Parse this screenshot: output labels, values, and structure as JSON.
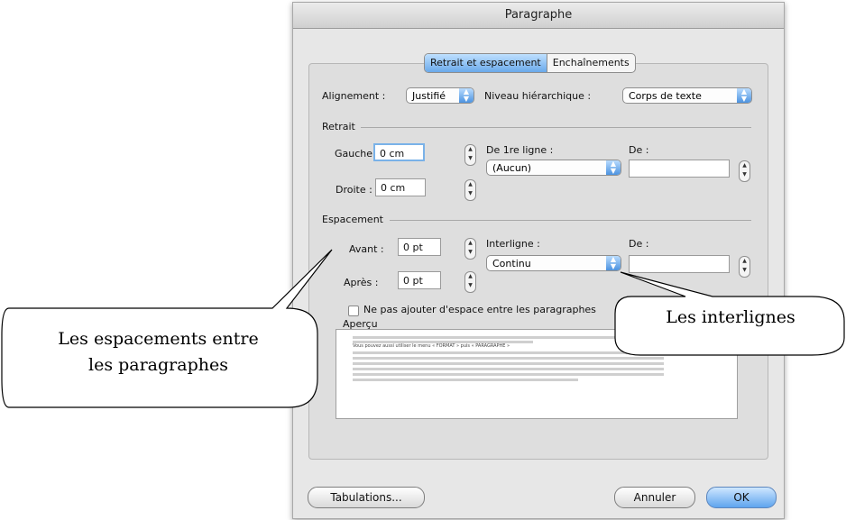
{
  "dialog": {
    "title": "Paragraphe",
    "tabs": [
      "Retrait et espacement",
      "Enchaînements"
    ],
    "alignment": {
      "label": "Alignement :",
      "value": "Justifié"
    },
    "level": {
      "label": "Niveau hiérarchique :",
      "value": "Corps de texte"
    },
    "indent": {
      "section": "Retrait",
      "left_label": "Gauche :",
      "left_value": "0 cm",
      "right_label": "Droite :",
      "right_value": "0 cm",
      "first_line_label": "De 1re ligne :",
      "first_line_value": "(Aucun)",
      "by_label": "De :",
      "by_value": ""
    },
    "spacing": {
      "section": "Espacement",
      "before_label": "Avant :",
      "before_value": "0 pt",
      "after_label": "Après :",
      "after_value": "0 pt",
      "line_label": "Interligne :",
      "line_value": "Continu",
      "at_label": "De :",
      "at_value": ""
    },
    "checkbox": {
      "label": "Ne pas ajouter d'espace entre les paragraphes",
      "checked": false
    },
    "preview": {
      "label": "Aperçu",
      "sample_line": "Vous pouvez aussi utiliser le menu « FORMAT » puis « PARAGRAPHE »"
    },
    "buttons": {
      "tabs": "Tabulations...",
      "cancel": "Annuler",
      "ok": "OK"
    }
  },
  "callouts": {
    "left": [
      "Les espacements entre",
      "les paragraphes"
    ],
    "right": "Les interlignes"
  }
}
